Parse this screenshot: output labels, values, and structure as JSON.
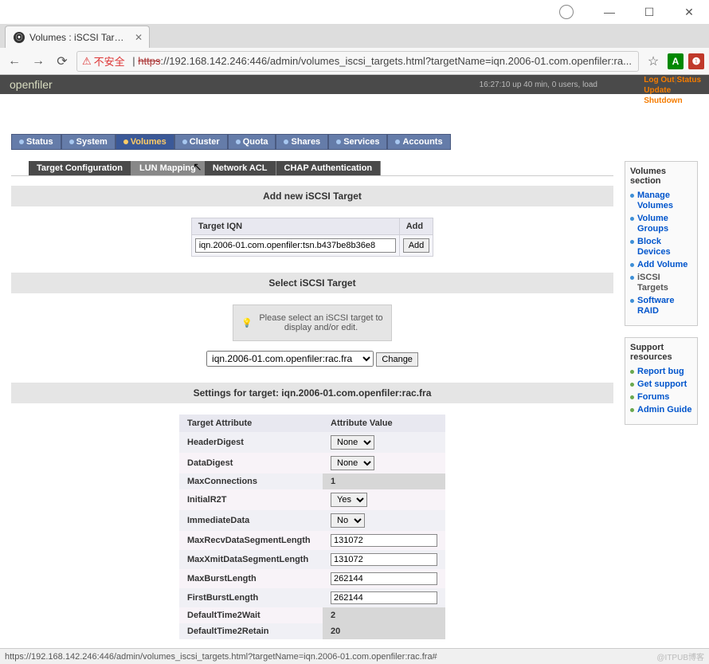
{
  "window": {
    "min": "—",
    "max": "☐",
    "close": "✕"
  },
  "tab": {
    "title": "Volumes : iSCSI Target",
    "close": "✕"
  },
  "nav": {
    "back": "←",
    "fwd": "→",
    "reload": "⟳",
    "warn_icon": "⚠",
    "insecure": "不安全",
    "proto": "https",
    "url": "://192.168.142.246:446/admin/volumes_iscsi_targets.html?targetName=iqn.2006-01.com.openfiler:ra...",
    "star": "☆",
    "extA": "A",
    "extAB": "❶"
  },
  "brand": "openfiler",
  "uptime": "16:27:10 up 40 min, 0 users, load",
  "quick": {
    "logout": "Log Out",
    "status": "Status",
    "update": "Update",
    "shutdown": "Shutdown"
  },
  "mainnav": [
    "Status",
    "System",
    "Volumes",
    "Cluster",
    "Quota",
    "Shares",
    "Services",
    "Accounts"
  ],
  "subnav": [
    "Target Configuration",
    "LUN Mapping",
    "Network ACL",
    "CHAP Authentication"
  ],
  "sections": {
    "add": "Add new iSCSI Target",
    "select": "Select iSCSI Target",
    "settings": "Settings for target: iqn.2006-01.com.openfiler:rac.fra"
  },
  "add_form": {
    "h_iqn": "Target IQN",
    "h_add": "Add",
    "iqn_value": "iqn.2006-01.com.openfiler:tsn.b437be8b36e8",
    "btn": "Add"
  },
  "info": "Please select an iSCSI target to display and/or edit.",
  "select_form": {
    "option": "iqn.2006-01.com.openfiler:rac.fra",
    "btn": "Change"
  },
  "attr_hdr": {
    "a": "Target Attribute",
    "v": "Attribute Value"
  },
  "attrs": [
    {
      "name": "HeaderDigest",
      "type": "select",
      "value": "None"
    },
    {
      "name": "DataDigest",
      "type": "select",
      "value": "None"
    },
    {
      "name": "MaxConnections",
      "type": "ro",
      "value": "1"
    },
    {
      "name": "InitialR2T",
      "type": "select",
      "value": "Yes"
    },
    {
      "name": "ImmediateData",
      "type": "select",
      "value": "No"
    },
    {
      "name": "MaxRecvDataSegmentLength",
      "type": "input",
      "value": "131072"
    },
    {
      "name": "MaxXmitDataSegmentLength",
      "type": "input",
      "value": "131072"
    },
    {
      "name": "MaxBurstLength",
      "type": "input",
      "value": "262144"
    },
    {
      "name": "FirstBurstLength",
      "type": "input",
      "value": "262144"
    },
    {
      "name": "DefaultTime2Wait",
      "type": "ro",
      "value": "2"
    },
    {
      "name": "DefaultTime2Retain",
      "type": "ro",
      "value": "20"
    }
  ],
  "sidebar": {
    "vol_hdr": "Volumes section",
    "vol_links": [
      "Manage Volumes",
      "Volume Groups",
      "Block Devices",
      "Add Volume",
      "iSCSI Targets",
      "Software RAID"
    ],
    "sup_hdr": "Support resources",
    "sup_links": [
      "Report bug",
      "Get support",
      "Forums",
      "Admin Guide"
    ]
  },
  "statusbar": "https://192.168.142.246:446/admin/volumes_iscsi_targets.html?targetName=iqn.2006-01.com.openfiler:rac.fra#",
  "watermark": "@ITPUB博客"
}
